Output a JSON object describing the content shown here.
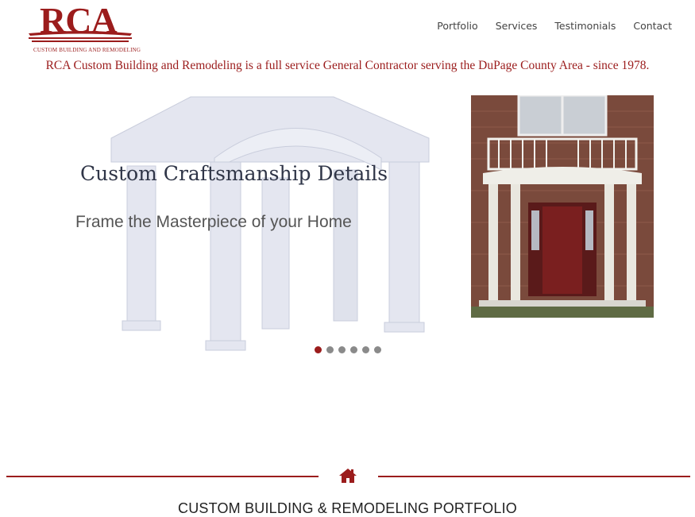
{
  "logo": {
    "text": "RCA",
    "subtext": "CUSTOM BUILDING AND REMODELING"
  },
  "nav": {
    "items": [
      {
        "label": "Portfolio"
      },
      {
        "label": "Services"
      },
      {
        "label": "Testimonials"
      },
      {
        "label": "Contact"
      }
    ]
  },
  "tagline": "RCA Custom Building and Remodeling is a full service General Contractor serving the DuPage County Area - since 1978.",
  "slider": {
    "title": "Custom Craftsmanship Details",
    "subtitle": "Frame the Masterpiece of your Home",
    "dots_count": 6,
    "active_index": 0
  },
  "section": {
    "icon": "home-icon",
    "title": "CUSTOM BUILDING & REMODELING PORTFOLIO"
  },
  "colors": {
    "brand_red": "#9b1c1c",
    "dot_gray": "#8a8a8a",
    "text_dark": "#2f3547"
  }
}
